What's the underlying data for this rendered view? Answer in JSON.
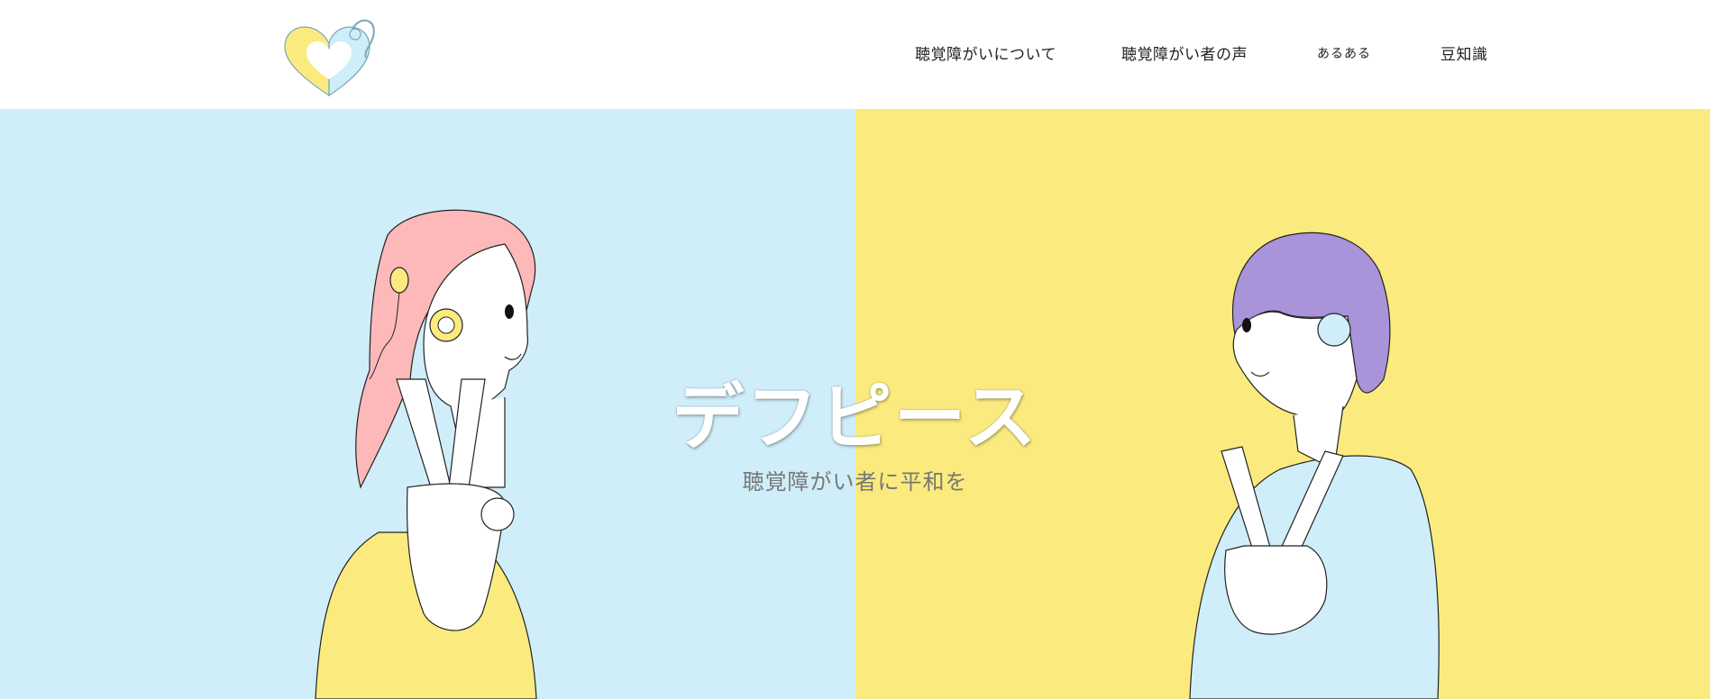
{
  "header": {
    "logo": {
      "icon": "heart-hearing-aid-logo",
      "colors": [
        "#fbeb7f",
        "#cfeefa"
      ]
    }
  },
  "nav": {
    "items": [
      {
        "label": "聴覚障がいについて"
      },
      {
        "label": "聴覚障がい者の声"
      },
      {
        "label": "あるある"
      },
      {
        "label": "豆知識"
      }
    ]
  },
  "hero": {
    "title": "デフピース",
    "subtitle": "聴覚障がい者に平和を",
    "colors": {
      "left": "#cfeefa",
      "right": "#fbeb7f"
    },
    "figures": [
      {
        "icon": "woman-peace-sign-illustration"
      },
      {
        "icon": "man-peace-sign-illustration"
      }
    ]
  }
}
